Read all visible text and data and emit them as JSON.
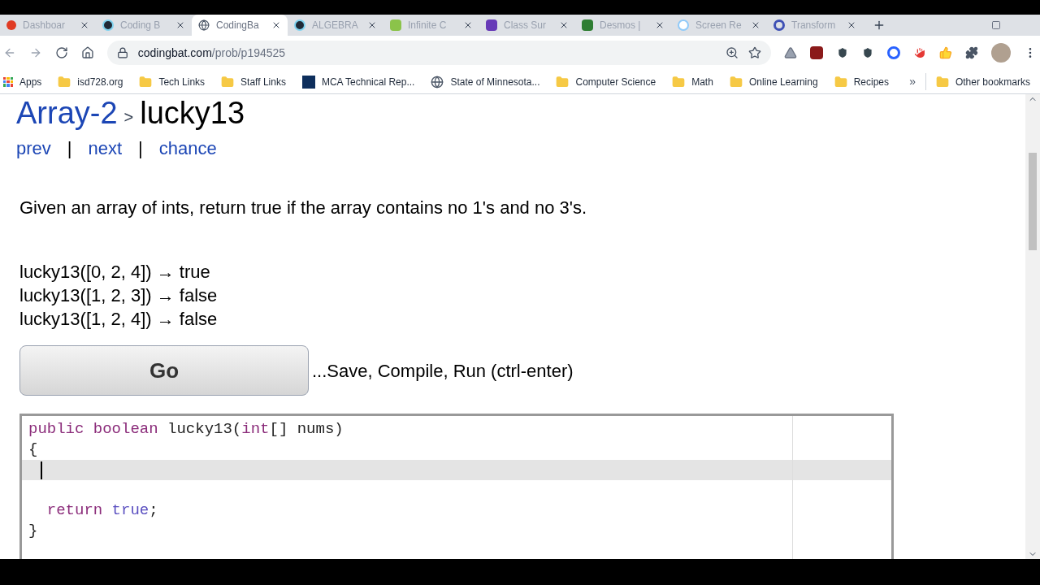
{
  "tabs": [
    {
      "title": "Dashboar",
      "selected": false
    },
    {
      "title": "Coding B",
      "selected": false
    },
    {
      "title": "CodingBa",
      "selected": true
    },
    {
      "title": "ALGEBRA",
      "selected": false
    },
    {
      "title": "Infinite C",
      "selected": false
    },
    {
      "title": "Class Sur",
      "selected": false
    },
    {
      "title": "Desmos |",
      "selected": false
    },
    {
      "title": "Screen Re",
      "selected": false
    },
    {
      "title": "Transform",
      "selected": false
    }
  ],
  "address": {
    "domain": "codingbat.com",
    "path": "/prob/p194525"
  },
  "bookmarks": [
    {
      "label": "Apps",
      "kind": "apps"
    },
    {
      "label": "isd728.org",
      "kind": "folder"
    },
    {
      "label": "Tech Links",
      "kind": "folder"
    },
    {
      "label": "Staff Links",
      "kind": "folder"
    },
    {
      "label": "MCA Technical Rep...",
      "kind": "site"
    },
    {
      "label": "State of Minnesota...",
      "kind": "globe"
    },
    {
      "label": "Computer Science",
      "kind": "folder"
    },
    {
      "label": "Math",
      "kind": "folder"
    },
    {
      "label": "Online Learning",
      "kind": "folder"
    },
    {
      "label": "Recipes",
      "kind": "folder"
    }
  ],
  "bookmarks_overflow": "»",
  "other_bookmarks": "Other bookmarks",
  "page": {
    "section": "Array-2",
    "separator": ">",
    "problem": "lucky13",
    "nav": [
      "prev",
      "|",
      "next",
      "|",
      "chance"
    ],
    "description": "Given an array of ints, return true if the array contains no 1's and no 3's.",
    "examples": [
      "lucky13([0, 2, 4]) → true",
      "lucky13([1, 2, 3]) → false",
      "lucky13([1, 2, 4]) → false"
    ],
    "go_button": "Go",
    "go_hint": "...Save, Compile, Run (ctrl-enter)",
    "code_lines": [
      {
        "current": false,
        "tokens": [
          {
            "kind": "keyword",
            "text": "public boolean"
          },
          {
            "kind": "plain",
            "text": " lucky13("
          },
          {
            "kind": "keyword",
            "text": "int"
          },
          {
            "kind": "plain",
            "text": "[] nums)"
          }
        ]
      },
      {
        "current": false,
        "tokens": [
          {
            "kind": "plain",
            "text": "{"
          }
        ]
      },
      {
        "current": true
      },
      {
        "current": false
      },
      {
        "current": false,
        "tokens": [
          {
            "kind": "keyword",
            "text": "  return"
          },
          {
            "kind": "literal",
            "text": " true"
          },
          {
            "kind": "plain",
            "text": ";"
          }
        ]
      },
      {
        "current": false,
        "tokens": [
          {
            "kind": "plain",
            "text": "}"
          }
        ]
      }
    ]
  }
}
